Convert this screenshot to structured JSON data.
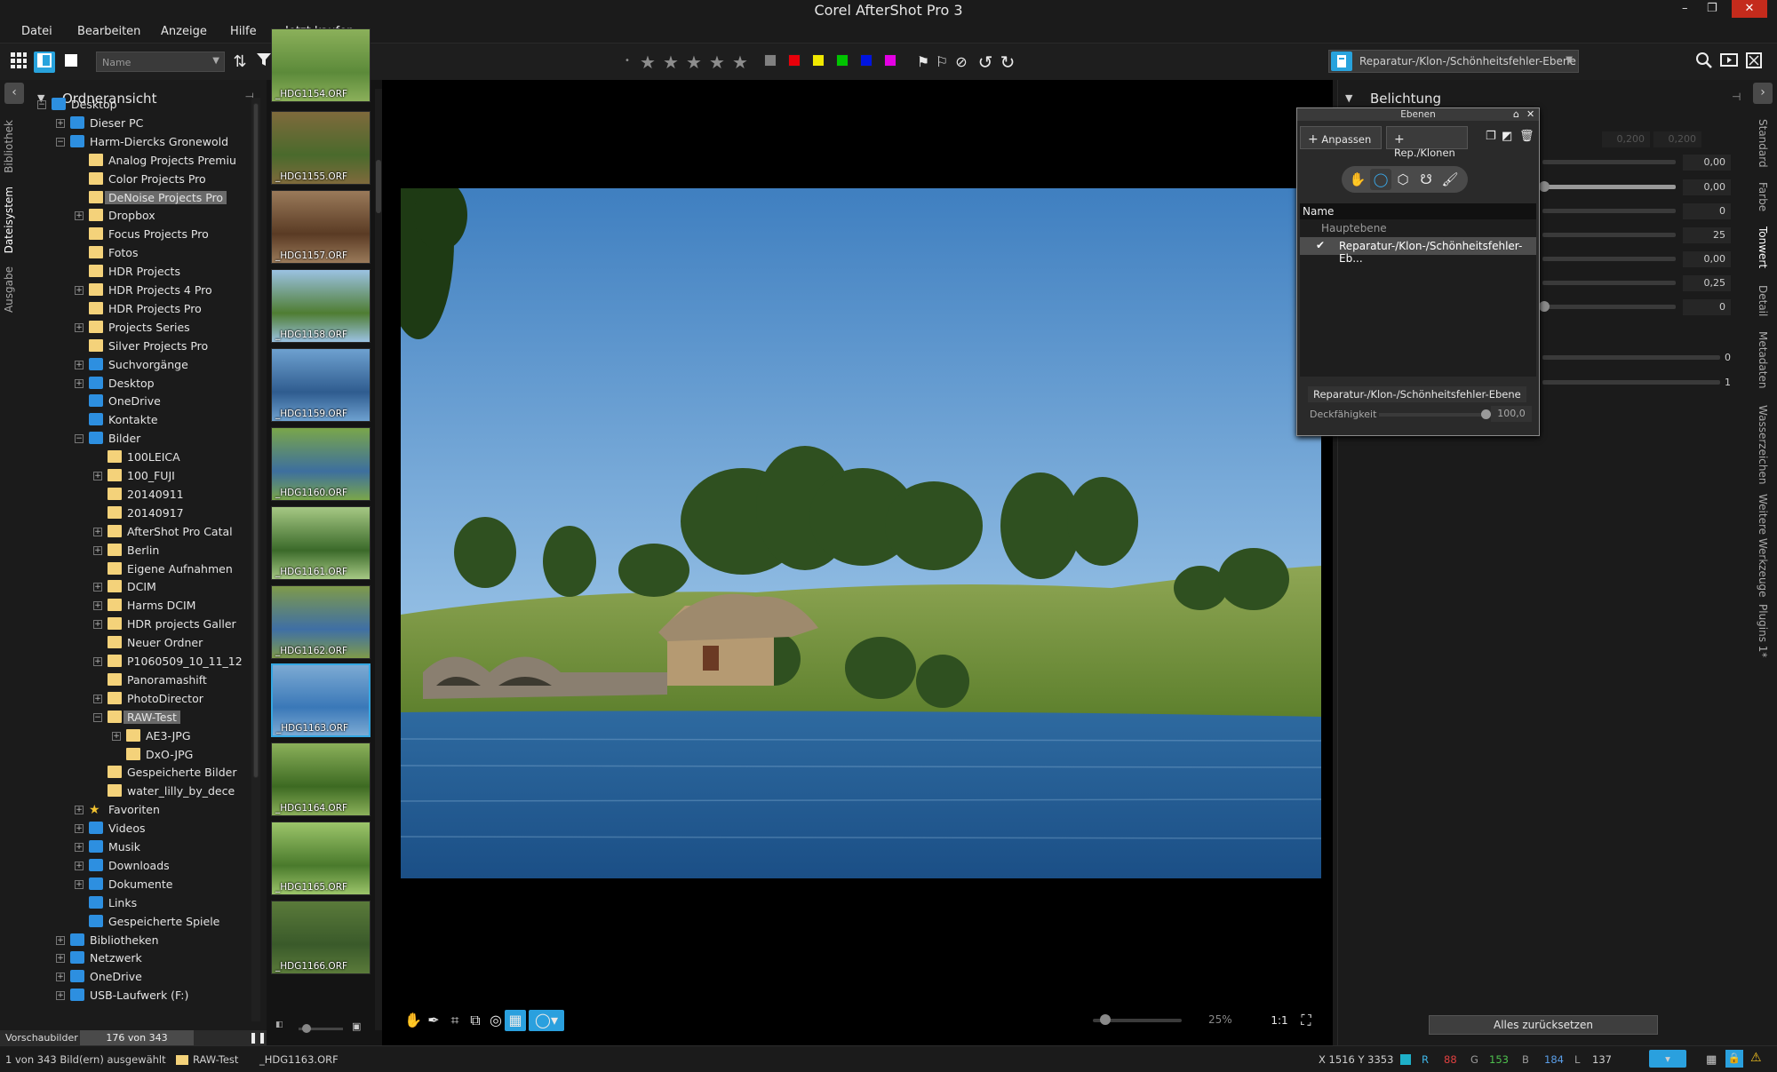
{
  "window": {
    "title": "Corel AfterShot Pro 3"
  },
  "menu": [
    "Datei",
    "Bearbeiten",
    "Anzeige",
    "Hilfe",
    "Jetzt kaufen"
  ],
  "toolbar": {
    "sort_value": "Name",
    "color_labels": [
      "#808080",
      "#e8000a",
      "#f0e800",
      "#00c400",
      "#0014e0",
      "#e400e4"
    ],
    "layer_select": "Reparatur-/Klon-/Schönheitsfehler-Ebene"
  },
  "left_rail": {
    "tabs": [
      "Bibliothek",
      "Dateisystem",
      "Ausgabe"
    ],
    "active": "Dateisystem"
  },
  "tree": {
    "header": "Ordneransicht",
    "items": [
      {
        "label": "Desktop",
        "icon": "desktop-icon"
      },
      {
        "label": "Dieser PC",
        "icon": "pc-icon"
      },
      {
        "label": "Harm-Diercks Gronewold",
        "icon": "user-icon"
      },
      {
        "label": "Analog Projects Premiu",
        "icon": "folder-icon"
      },
      {
        "label": "Color Projects Pro",
        "icon": "folder-icon"
      },
      {
        "label": "DeNoise Projects Pro",
        "icon": "folder-icon"
      },
      {
        "label": "Dropbox",
        "icon": "folder-icon"
      },
      {
        "label": "Focus Projects Pro",
        "icon": "folder-icon"
      },
      {
        "label": "Fotos",
        "icon": "folder-icon"
      },
      {
        "label": "HDR Projects",
        "icon": "folder-icon"
      },
      {
        "label": "HDR Projects 4 Pro",
        "icon": "folder-icon"
      },
      {
        "label": "HDR Projects Pro",
        "icon": "folder-icon"
      },
      {
        "label": "Projects Series",
        "icon": "folder-icon"
      },
      {
        "label": "Silver Projects Pro",
        "icon": "folder-icon"
      },
      {
        "label": "Suchvorgänge",
        "icon": "search-folder-icon"
      },
      {
        "label": "Desktop",
        "icon": "desktop-folder-icon"
      },
      {
        "label": "OneDrive",
        "icon": "cloud-icon"
      },
      {
        "label": "Kontakte",
        "icon": "contacts-icon"
      },
      {
        "label": "Bilder",
        "icon": "pictures-icon"
      },
      {
        "label": "100LEICA",
        "icon": "folder-icon"
      },
      {
        "label": "100_FUJI",
        "icon": "folder-icon"
      },
      {
        "label": "20140911",
        "icon": "folder-icon"
      },
      {
        "label": "20140917",
        "icon": "folder-icon"
      },
      {
        "label": "AfterShot Pro Catal",
        "icon": "folder-icon"
      },
      {
        "label": "Berlin",
        "icon": "folder-icon"
      },
      {
        "label": "Eigene Aufnahmen",
        "icon": "folder-icon"
      },
      {
        "label": "DCIM",
        "icon": "folder-icon"
      },
      {
        "label": "Harms DCIM",
        "icon": "folder-icon"
      },
      {
        "label": "HDR projects Galler",
        "icon": "folder-icon"
      },
      {
        "label": "Neuer Ordner",
        "icon": "folder-icon"
      },
      {
        "label": "P1060509_10_11_12",
        "icon": "folder-icon"
      },
      {
        "label": "Panoramashift",
        "icon": "folder-icon"
      },
      {
        "label": "PhotoDirector",
        "icon": "folder-icon"
      },
      {
        "label": "RAW-Test",
        "icon": "folder-icon"
      },
      {
        "label": "AE3-JPG",
        "icon": "folder-icon"
      },
      {
        "label": "DxO-JPG",
        "icon": "folder-icon"
      },
      {
        "label": "Gespeicherte Bilder",
        "icon": "folder-icon"
      },
      {
        "label": "water_lilly_by_dece",
        "icon": "folder-icon"
      },
      {
        "label": "Favoriten",
        "icon": "star-icon"
      },
      {
        "label": "Videos",
        "icon": "video-icon"
      },
      {
        "label": "Musik",
        "icon": "music-icon"
      },
      {
        "label": "Downloads",
        "icon": "download-icon"
      },
      {
        "label": "Dokumente",
        "icon": "document-icon"
      },
      {
        "label": "Links",
        "icon": "link-icon"
      },
      {
        "label": "Gespeicherte Spiele",
        "icon": "games-icon"
      },
      {
        "label": "Bibliotheken",
        "icon": "library-icon"
      },
      {
        "label": "Netzwerk",
        "icon": "network-icon"
      },
      {
        "label": "OneDrive",
        "icon": "cloud-icon"
      },
      {
        "label": "USB-Laufwerk (F:)",
        "icon": "drive-icon"
      }
    ]
  },
  "preview": {
    "label": "Vorschaubilder",
    "count": "176 von 343"
  },
  "filmstrip": [
    "_HDG1154.ORF",
    "_HDG1155.ORF",
    "_HDG1157.ORF",
    "_HDG1158.ORF",
    "_HDG1159.ORF",
    "_HDG1160.ORF",
    "_HDG1161.ORF",
    "_HDG1162.ORF",
    "_HDG1163.ORF",
    "_HDG1164.ORF",
    "_HDG1165.ORF",
    "_HDG1166.ORF"
  ],
  "viewer": {
    "zoom": "25%"
  },
  "right_panel": {
    "header": "Belichtung",
    "disabled_values": [
      "0,200",
      "0,200"
    ],
    "values": [
      "0,00",
      "0,00",
      "0",
      "25",
      "0,00",
      "0,25",
      "0",
      "0",
      "1"
    ],
    "reset": "Alles zurücksetzen"
  },
  "right_rail": [
    "Standard",
    "Farbe",
    "Tonwert",
    "Detail",
    "Metadaten",
    "Wasserzeichen",
    "Weitere Werkzeuge",
    "Plugins 1*"
  ],
  "right_rail_active": "Tonwert",
  "layers": {
    "title": "Ebenen",
    "btn_adjust": "Anpassen",
    "btn_clone": "Rep./Klonen",
    "list_header": "Name",
    "rows": [
      "Hauptebene",
      "Reparatur-/Klon-/Schönheitsfehler-Eb..."
    ],
    "layer_name": "Reparatur-/Klon-/Schönheitsfehler-Ebene",
    "opacity_label": "Deckfähigkeit",
    "opacity_value": "100,0"
  },
  "status": {
    "selection": "1 von 343 Bild(ern) ausgewählt",
    "folder": "RAW-Test",
    "file": "_HDG1163.ORF",
    "coords": "X 1516  Y 3353",
    "r_label": "R",
    "r": "88",
    "g_label": "G",
    "g": "153",
    "b_label": "B",
    "b": "184",
    "l_label": "L",
    "l": "137"
  }
}
